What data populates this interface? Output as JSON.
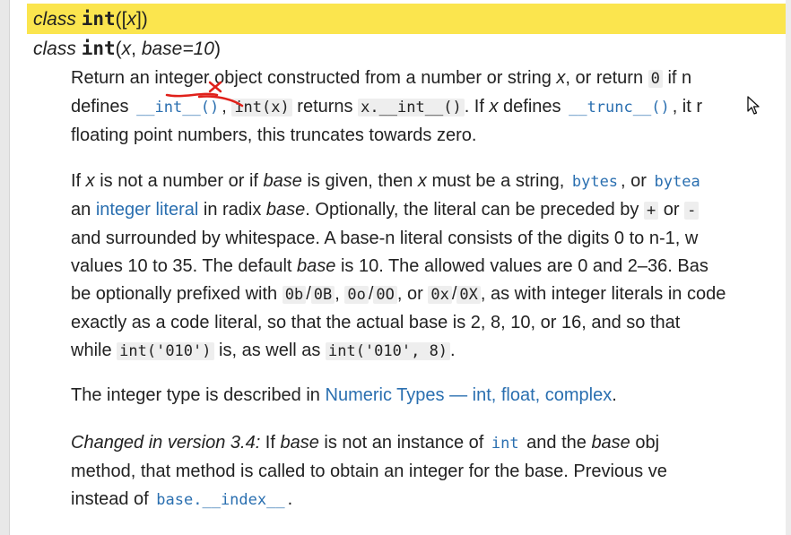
{
  "sig1": {
    "class_kw": "class",
    "name": "int",
    "open": "([",
    "arg": "x",
    "close": "])"
  },
  "sig2": {
    "class_kw": "class",
    "name": "int",
    "open": "(",
    "arg": "x",
    "sep": ", ",
    "kw": "base=10",
    "close": ")"
  },
  "p1": {
    "l1a": "Return an integer object constructed from a number or string ",
    "l1x": "x",
    "l1b": ", or return ",
    "l1code": "0",
    "l1c": " if n",
    "l2a": "defines ",
    "l2code1": "__int__()",
    "l2b": ", ",
    "l2code2": "int(x)",
    "l2c": " returns ",
    "l2code3": "x.__int__()",
    "l2d": ". If ",
    "l2x": "x",
    "l2e": " defines ",
    "l2code4": "__trunc__()",
    "l2f": ", it r",
    "l3": "floating point numbers, this truncates towards zero."
  },
  "p2": {
    "l1a": "If ",
    "l1x": "x",
    "l1b": " is not a number or if ",
    "l1base": "base",
    "l1c": " is given, then ",
    "l1x2": "x",
    "l1d": " must be a string, ",
    "l1code1": "bytes",
    "l1e": ", or ",
    "l1code2": "bytea",
    "l2a": "an ",
    "l2link": "integer literal",
    "l2b": " in radix ",
    "l2base": "base",
    "l2c": ". Optionally, the literal can be preceded by ",
    "l2code1": "+",
    "l2d": " or ",
    "l2code2": "-",
    "l3": "and surrounded by whitespace. A base-n literal consists of the digits 0 to n-1, w",
    "l4a": "values 10 to 35. The default ",
    "l4base": "base",
    "l4b": " is 10. The allowed values are 0 and 2–36. Bas",
    "l5a": "be optionally prefixed with ",
    "l5code1": "0b",
    "l5s1": "/",
    "l5code2": "0B",
    "l5b": ", ",
    "l5code3": "0o",
    "l5s2": "/",
    "l5code4": "0O",
    "l5c": ", or ",
    "l5code5": "0x",
    "l5s3": "/",
    "l5code6": "0X",
    "l5d": ", as with integer literals in code",
    "l6": "exactly as a code literal, so that the actual base is 2, 8, 10, or 16, and so that",
    "l7a": "while ",
    "l7code1": "int('010')",
    "l7b": " is, as well as ",
    "l7code2": "int('010', 8)",
    "l7c": "."
  },
  "p3": {
    "a": "The integer type is described in ",
    "link": "Numeric Types — int, float, complex",
    "b": "."
  },
  "p4": {
    "l1em": "Changed in version 3.4:",
    "l1a": " If ",
    "l1base": "base",
    "l1b": " is not an instance of ",
    "l1code": "int",
    "l1c": " and the ",
    "l1base2": "base",
    "l1d": " obj",
    "l2": "method, that method is called to obtain an integer for the base. Previous ve",
    "l3a": "instead of ",
    "l3code": "base.__index__",
    "l3b": "."
  },
  "colors": {
    "highlight": "#fbe54e",
    "link": "#2a6fb0",
    "ink": "#e0201a"
  },
  "icons": {
    "cursor": "mouse-pointer-icon",
    "annotation": "red-ink-underline"
  }
}
